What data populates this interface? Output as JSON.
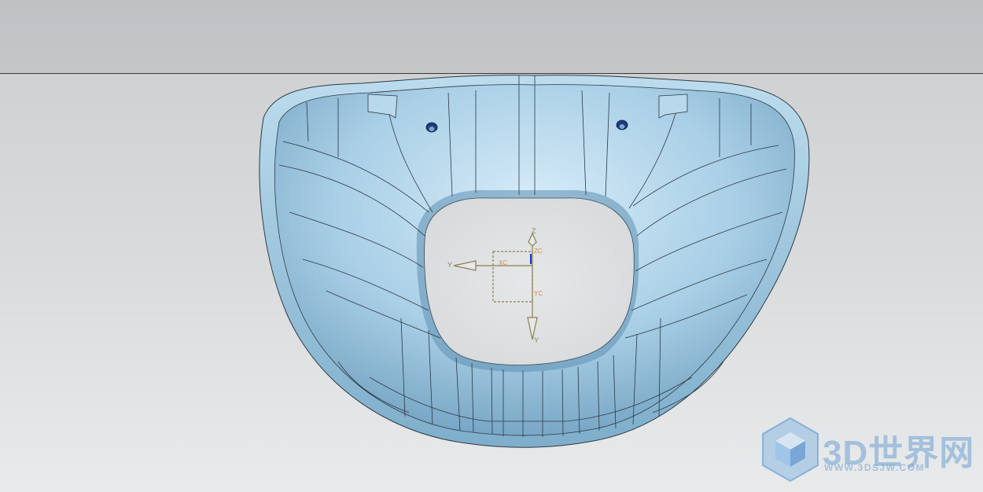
{
  "viewport": {
    "background_top": "#bfc1c4",
    "background_bottom": "#e8eaeb",
    "model_color": "#a9cfe6",
    "edge_color": "#2d3a45"
  },
  "csys": {
    "z_label": "Z",
    "y_label": "Y",
    "yprime_label": "Y",
    "zc_label": "ZC",
    "xc_label": "XC",
    "yc_label": "YC",
    "color": "#8a7f55"
  },
  "watermark": {
    "title": "3D世界网",
    "url": "WWW.3DSJW.COM",
    "icon": "cube-logo-icon"
  }
}
